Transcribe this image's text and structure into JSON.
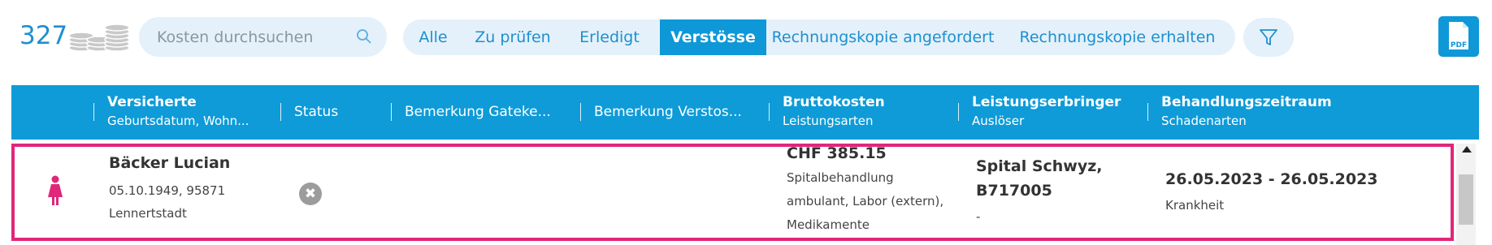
{
  "toolbar": {
    "count": "327",
    "coins_icon": "coins-icon",
    "search": {
      "placeholder": "Kosten durchsuchen",
      "value": "",
      "icon": "search-icon"
    },
    "filters": [
      {
        "label": "Alle",
        "active": false
      },
      {
        "label": "Zu prüfen",
        "active": false
      },
      {
        "label": "Erledigt",
        "active": false
      },
      {
        "label": "Verstösse",
        "active": true
      },
      {
        "label": "Rechnungskopie angefordert",
        "active": false
      },
      {
        "label": "Rechnungskopie erhalten",
        "active": false
      }
    ],
    "filter_icon": "funnel-icon",
    "pdf_label": "PDF"
  },
  "table": {
    "columns": [
      {
        "main": "Versicherte",
        "sub": "Geburtsdatum, Wohn..."
      },
      {
        "main": "Status",
        "sub": ""
      },
      {
        "main": "Bemerkung Gateke...",
        "sub": ""
      },
      {
        "main": "Bemerkung Verstos...",
        "sub": ""
      },
      {
        "main": "Bruttokosten",
        "sub": "Leistungsarten"
      },
      {
        "main": "Leistungserbringer",
        "sub": "Auslöser"
      },
      {
        "main": "Behandlungszeitraum",
        "sub": "Schadenarten"
      }
    ],
    "rows": [
      {
        "gender_icon": "female-person-icon",
        "name": "Bäcker Lucian",
        "birthdate_zip": "05.10.1949, 95871",
        "city": "Lennertstadt",
        "status_icon": "x-circle-icon",
        "cost": "CHF 385.15",
        "service_types": [
          "Spitalbehandlung",
          "ambulant, Labor (extern),",
          "Medikamente"
        ],
        "provider": [
          "Spital Schwyz,",
          "B717005"
        ],
        "trigger": "-",
        "period": "26.05.2023 - 26.05.2023",
        "damage_type": "Krankheit"
      }
    ]
  },
  "colors": {
    "accent": "#0e9bd8",
    "highlight_border": "#e0277a",
    "filter_bg": "#e4f1fa",
    "female_icon": "#e0277a"
  }
}
